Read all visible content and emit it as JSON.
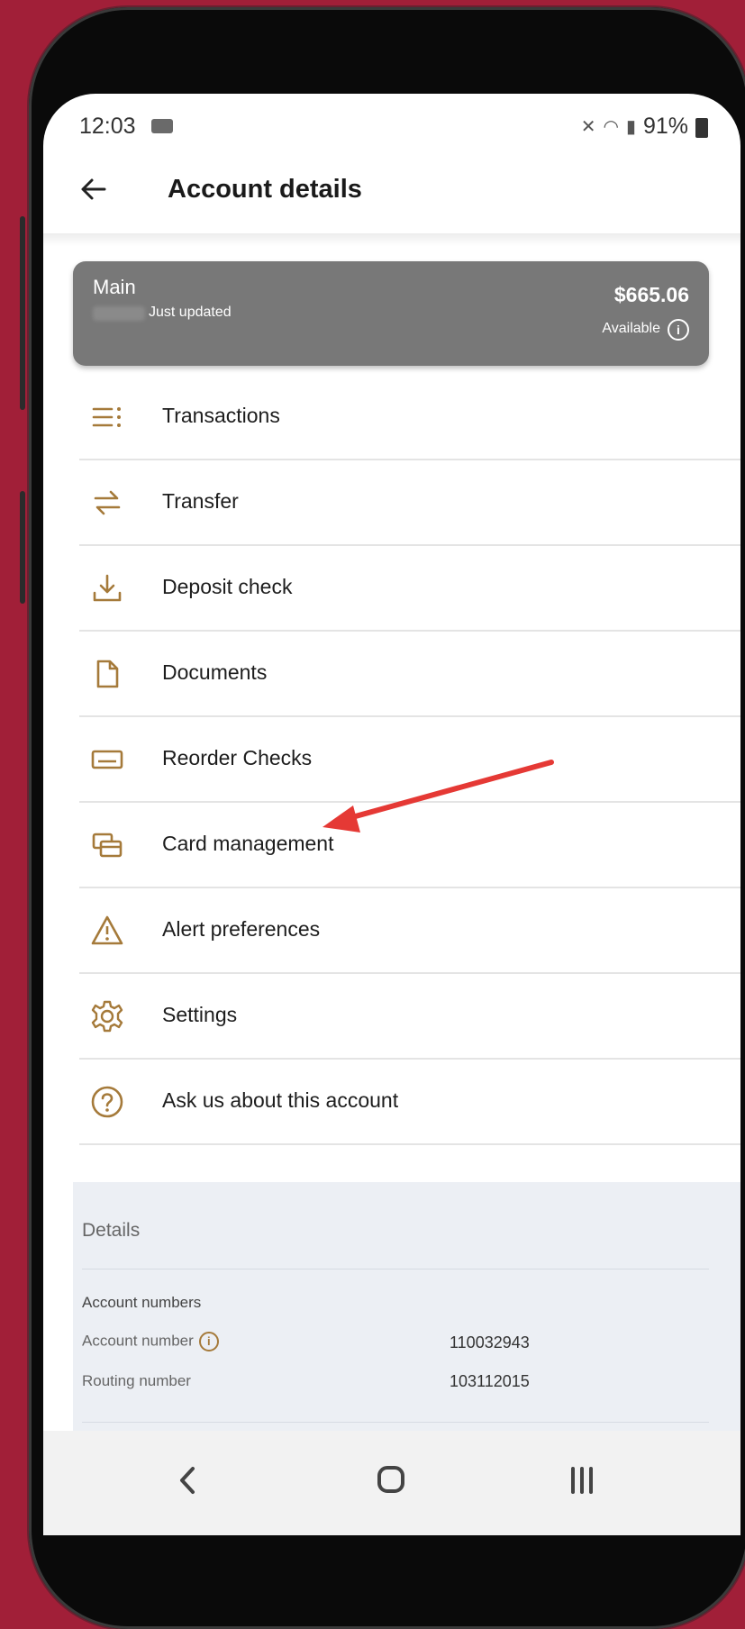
{
  "status": {
    "time": "12:03",
    "battery": "91%"
  },
  "header": {
    "title": "Account details"
  },
  "account_card": {
    "name": "Main",
    "updated": "Just updated",
    "balance": "$665.06",
    "balance_label": "Available"
  },
  "menu": [
    {
      "label": "Transactions",
      "icon": "list-icon"
    },
    {
      "label": "Transfer",
      "icon": "transfer-icon"
    },
    {
      "label": "Deposit check",
      "icon": "download-icon"
    },
    {
      "label": "Documents",
      "icon": "document-icon"
    },
    {
      "label": "Reorder Checks",
      "icon": "check-icon"
    },
    {
      "label": "Card management",
      "icon": "cards-icon"
    },
    {
      "label": "Alert preferences",
      "icon": "alert-icon"
    },
    {
      "label": "Settings",
      "icon": "gear-icon"
    },
    {
      "label": "Ask us about this account",
      "icon": "help-icon"
    }
  ],
  "details": {
    "heading": "Details",
    "section": "Account numbers",
    "account_number_label": "Account number",
    "account_number": "110032943",
    "routing_number_label": "Routing number",
    "routing_number": "103112015"
  },
  "colors": {
    "accent": "#a57a3a",
    "background": "#a11f38",
    "card": "#787878",
    "annotation_arrow": "#e53935"
  }
}
